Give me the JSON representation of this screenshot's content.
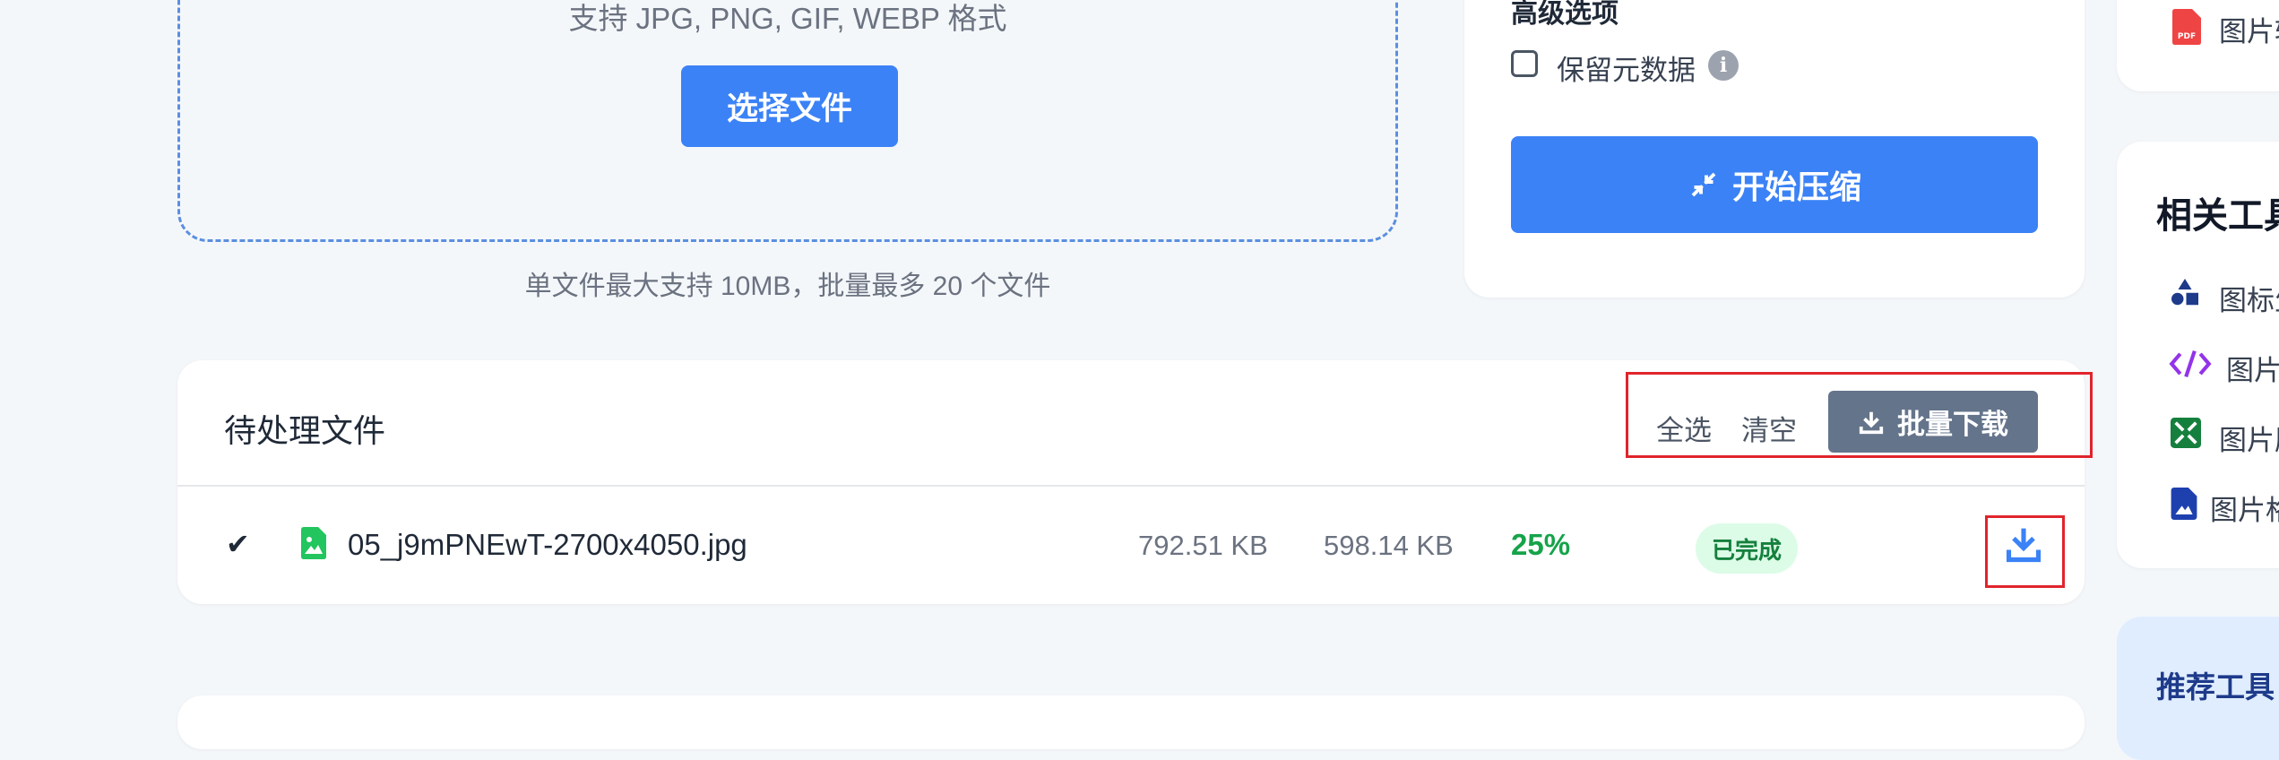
{
  "upload": {
    "formats_text": "支持 JPG, PNG, GIF, WEBP 格式",
    "choose_button": "选择文件",
    "limit_text": "单文件最大支持 10MB，批量最多 20 个文件"
  },
  "settings": {
    "advanced_title": "高级选项",
    "keep_metadata_label": "保留元数据",
    "keep_metadata_checked": false,
    "info_glyph": "i",
    "start_button": "开始压缩"
  },
  "file_list": {
    "title": "待处理文件",
    "select_all": "全选",
    "clear": "清空",
    "batch_download": "批量下载",
    "files": [
      {
        "checked_mark": "✔",
        "name": "05_j9mPNEwT-2700x4050.jpg",
        "original_size": "792.51 KB",
        "compressed_size": "598.14 KB",
        "ratio": "25%",
        "status": "已完成"
      }
    ]
  },
  "sidebar": {
    "top_item_label": "图片转",
    "related_title": "相关工具",
    "related_tools": [
      {
        "icon": "shapes-icon",
        "label": "图标生"
      },
      {
        "icon": "code-icon",
        "label": "图片"
      },
      {
        "icon": "compress-arrows-icon",
        "label": "图片压"
      },
      {
        "icon": "image-file-icon",
        "label": "图片格"
      }
    ],
    "recommended_title": "推荐工具"
  },
  "colors": {
    "accent": "#3b82f6",
    "batch_button": "#64748b",
    "success": "#16a34a",
    "highlight": "#e0242c"
  }
}
